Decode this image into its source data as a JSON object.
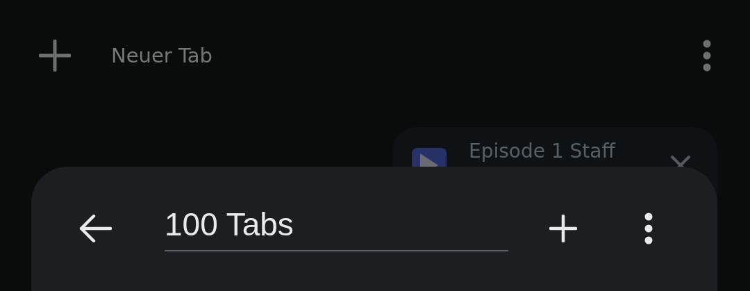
{
  "toolbar": {
    "new_tab_label": "Neuer Tab"
  },
  "tab_card": {
    "title": "Episode 1 Staff"
  },
  "group_sheet": {
    "title_field": {
      "value": "100 Tabs"
    }
  }
}
